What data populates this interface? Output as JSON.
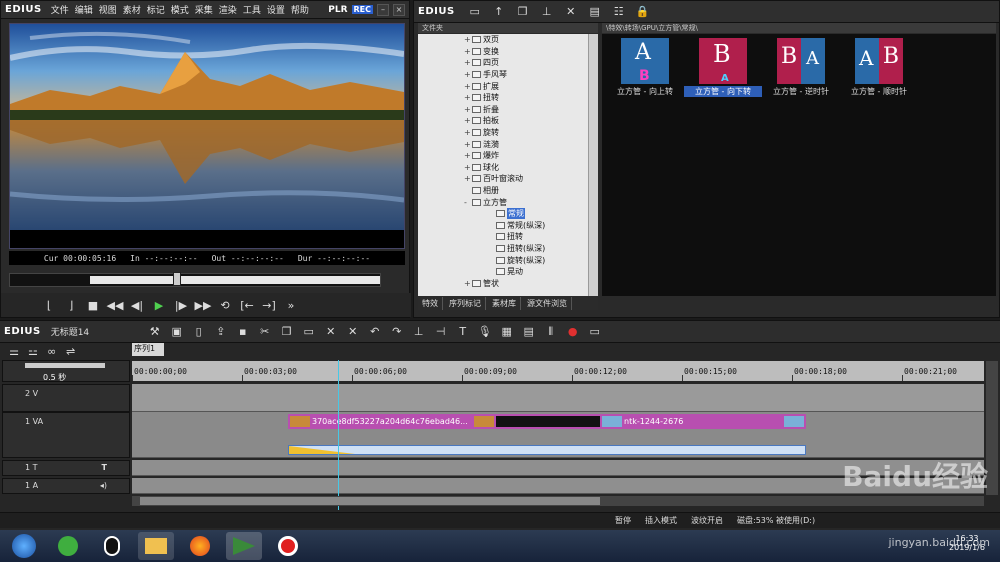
{
  "player": {
    "logo": "EDIUS",
    "menus": [
      "文件",
      "编辑",
      "视图",
      "素材",
      "标记",
      "模式",
      "采集",
      "渲染",
      "工具",
      "设置",
      "帮助"
    ],
    "mode_plr": "PLR",
    "mode_rec": "REC",
    "timecode": {
      "cur_label": "Cur",
      "cur": "00:00:05:16",
      "in_label": "In",
      "in": "--:--:--:--",
      "out_label": "Out",
      "out": "--:--:--:--",
      "dur_label": "Dur",
      "dur": "--:--:--:--"
    },
    "scrub_position": 0.45
  },
  "bin": {
    "logo": "EDIUS",
    "folder_header": "文件夹",
    "path": "\\特效\\转场\\GPU\\立方管\\常规\\",
    "tree": [
      {
        "label": "双页",
        "expander": "+"
      },
      {
        "label": "变换",
        "expander": "+"
      },
      {
        "label": "四页",
        "expander": "+"
      },
      {
        "label": "手风琴",
        "expander": "+"
      },
      {
        "label": "扩展",
        "expander": "+"
      },
      {
        "label": "扭转",
        "expander": "+"
      },
      {
        "label": "折叠",
        "expander": "+"
      },
      {
        "label": "拍板",
        "expander": "+"
      },
      {
        "label": "旋转",
        "expander": "+"
      },
      {
        "label": "涟漪",
        "expander": "+"
      },
      {
        "label": "爆炸",
        "expander": "+"
      },
      {
        "label": "球化",
        "expander": "+"
      },
      {
        "label": "百叶窗滚动",
        "expander": "+"
      },
      {
        "label": "相册",
        "expander": ""
      },
      {
        "label": "立方管",
        "expander": "-"
      },
      {
        "label": "常规",
        "expander": "",
        "child": true,
        "selected": true
      },
      {
        "label": "常规(纵深)",
        "expander": "",
        "child": true
      },
      {
        "label": "扭转",
        "expander": "",
        "child": true
      },
      {
        "label": "扭转(纵深)",
        "expander": "",
        "child": true
      },
      {
        "label": "旋转(纵深)",
        "expander": "",
        "child": true
      },
      {
        "label": "晃动",
        "expander": "",
        "child": true
      },
      {
        "label": "管状",
        "expander": "+"
      }
    ],
    "tabs": [
      "特效",
      "序列标记",
      "素材库",
      "源文件浏览"
    ],
    "clips": [
      {
        "label": "立方管 - 向上转",
        "letters": "A",
        "sub": "B"
      },
      {
        "label": "立方管 - 向下转",
        "letters": "B",
        "sub": "A",
        "selected": true
      },
      {
        "label": "立方管 - 逆时针",
        "letters": "B",
        "sub": "A"
      },
      {
        "label": "立方管 - 顺时针",
        "letters": "A",
        "sub": "B"
      }
    ]
  },
  "timeline": {
    "logo": "EDIUS",
    "project": "无标题14",
    "sequence_tab": "序列1",
    "zoom": "0.5 秒",
    "ruler": [
      "00:00:00;00",
      "00:00:03;00",
      "00:00:06;00",
      "00:00:09;00",
      "00:00:12;00",
      "00:00:15;00",
      "00:00:18;00",
      "00:00:21;00"
    ],
    "tracks": [
      {
        "name": "2 V"
      },
      {
        "name": "1 VA"
      },
      {
        "name": "1 T"
      },
      {
        "name": "1 A"
      }
    ],
    "clip1": "370ace8df53227a204d64c76ebad46...",
    "clip2": "ntk-1244-2676",
    "status": [
      "暂停",
      "插入模式",
      "波纹开启",
      "磁盘:53% 被使用(D:)"
    ]
  },
  "taskbar": {
    "time": "16:33",
    "date": "2019/1/6"
  },
  "watermark": {
    "brand": "Baidu经验",
    "url": "jingyan.baidu.com"
  }
}
